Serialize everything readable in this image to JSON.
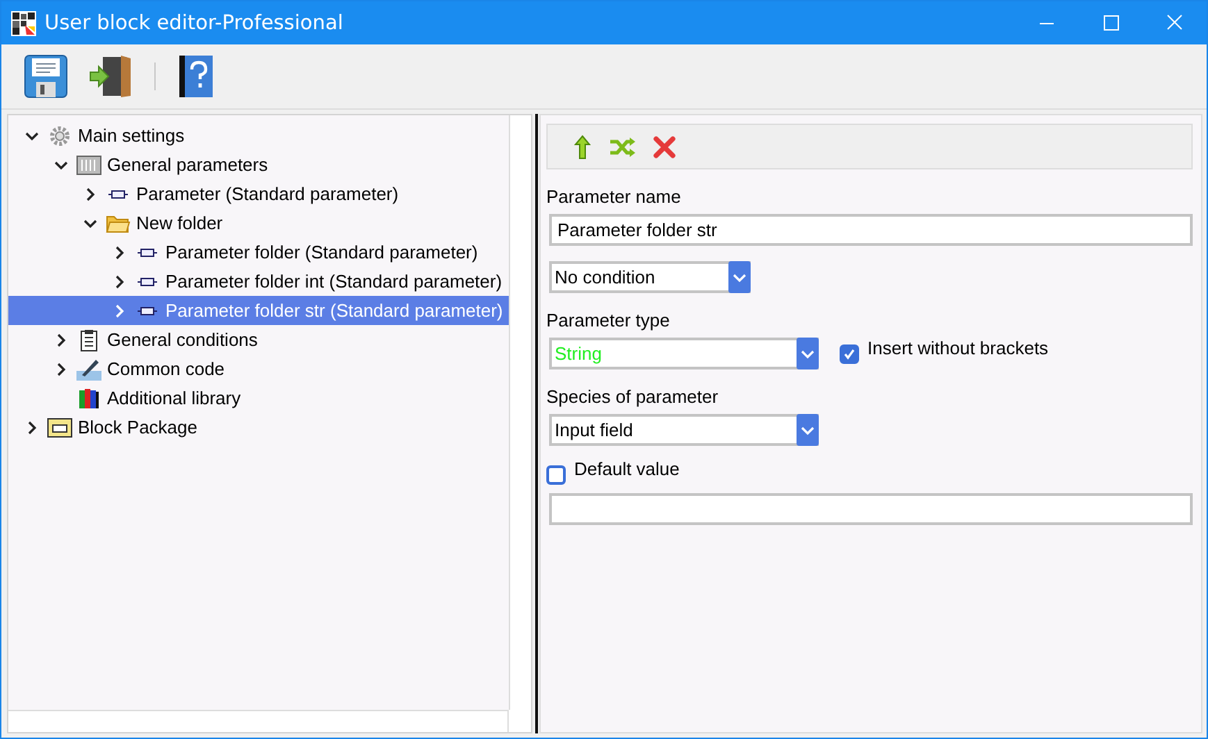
{
  "window": {
    "title": "User block editor-Professional"
  },
  "toolbar": [
    {
      "kind": "save"
    },
    {
      "kind": "exit"
    },
    {
      "kind": "separator"
    },
    {
      "kind": "help"
    }
  ],
  "tree": [
    {
      "label": "Main settings",
      "kind": "gear",
      "has_children": true,
      "expanded": true,
      "selected": false,
      "children": [
        {
          "label": "General parameters",
          "kind": "panel",
          "has_children": true,
          "expanded": true,
          "selected": false,
          "children": [
            {
              "label": "Parameter (Standard parameter)",
              "kind": "param",
              "has_children": true,
              "expanded": false,
              "selected": false
            },
            {
              "label": "New folder",
              "kind": "folder",
              "has_children": true,
              "expanded": true,
              "selected": false,
              "children": [
                {
                  "label": "Parameter folder (Standard parameter)",
                  "kind": "param",
                  "has_children": true,
                  "expanded": false,
                  "selected": false
                },
                {
                  "label": "Parameter folder int (Standard parameter)",
                  "kind": "param",
                  "has_children": true,
                  "expanded": false,
                  "selected": false
                },
                {
                  "label": "Parameter folder str (Standard parameter)",
                  "kind": "param",
                  "has_children": true,
                  "expanded": false,
                  "selected": true
                }
              ]
            }
          ]
        },
        {
          "label": "General conditions",
          "kind": "clipboard",
          "has_children": true,
          "expanded": false,
          "selected": false
        },
        {
          "label": "Common code",
          "kind": "pen",
          "has_children": true,
          "expanded": false,
          "selected": false
        },
        {
          "label": "Additional library",
          "kind": "books",
          "has_children": false,
          "expanded": false,
          "selected": false
        }
      ]
    },
    {
      "label": "Block Package",
      "kind": "package",
      "has_children": true,
      "expanded": false,
      "selected": false
    }
  ],
  "actions": [
    {
      "kind": "up"
    },
    {
      "kind": "shuffle"
    },
    {
      "kind": "delete"
    }
  ],
  "form": {
    "name_label": "Parameter name",
    "name_value": "Parameter folder str",
    "condition": {
      "value": "No condition"
    },
    "type_label": "Parameter type",
    "type": {
      "value": "String",
      "color": "#22ee22"
    },
    "insert_without_brackets": {
      "label": "Insert without brackets",
      "checked": true
    },
    "species_label": "Species of parameter",
    "species": {
      "value": "Input field"
    },
    "default_value": {
      "label": "Default value",
      "checked": false
    }
  }
}
